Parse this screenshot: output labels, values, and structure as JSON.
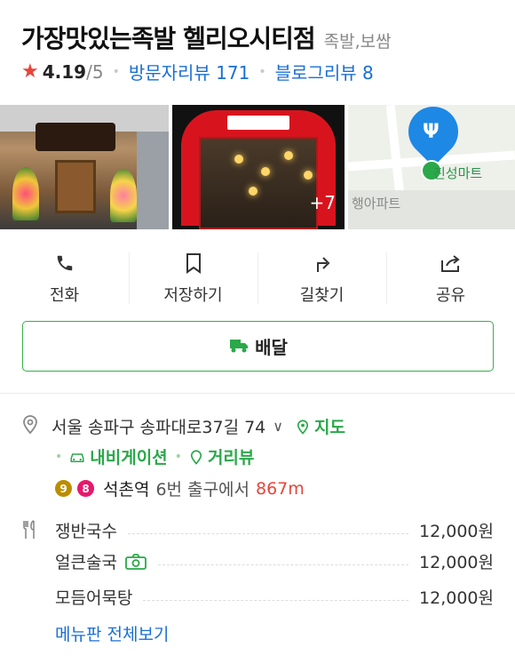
{
  "header": {
    "title": "가장맛있는족발 헬리오시티점",
    "category": "족발,보쌈"
  },
  "rating": {
    "score": "4.19",
    "max": "/5",
    "visitor_reviews": "방문자리뷰 171",
    "blog_reviews": "블로그리뷰 8"
  },
  "photos": {
    "more_count": "+7",
    "map_label_1": "진성마트",
    "map_label_2": "행아파트"
  },
  "actions": [
    {
      "label": "전화",
      "icon": "phone-icon"
    },
    {
      "label": "저장하기",
      "icon": "bookmark-icon"
    },
    {
      "label": "길찾기",
      "icon": "directions-icon"
    },
    {
      "label": "공유",
      "icon": "share-icon"
    }
  ],
  "delivery": {
    "label": "배달",
    "icon": "delivery-truck-icon"
  },
  "address": {
    "text": "서울 송파구 송파대로37길 74",
    "map_link": "지도",
    "navi_link": "내비게이션",
    "street_view_link": "거리뷰"
  },
  "subway": {
    "line_a": "9",
    "line_b": "8",
    "station": "석촌역",
    "exit": "6번 출구에서",
    "distance": "867m",
    "line_a_color": "#bb8c00",
    "line_b_color": "#e6186c"
  },
  "menu": {
    "items": [
      {
        "name": "쟁반국수",
        "price": "12,000원"
      },
      {
        "name": "얼큰술국",
        "price": "12,000원"
      },
      {
        "name": "모듬어묵탕",
        "price": "12,000원"
      }
    ],
    "view_all": "메뉴판 전체보기"
  },
  "colors": {
    "brand_green": "#2aa84a",
    "link_blue": "#1a6fd4",
    "star_red": "#e8443a"
  }
}
